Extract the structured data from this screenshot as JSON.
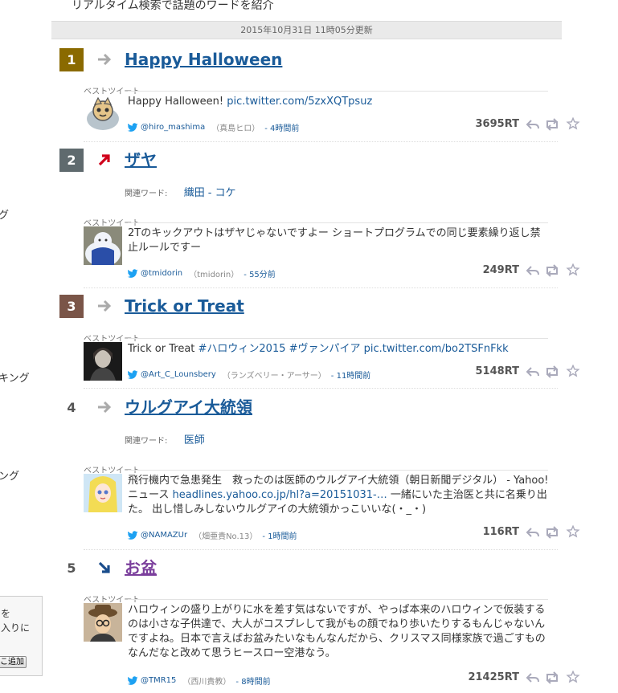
{
  "header": {
    "tagline": "リアルタイム検索で話題のワードを紹介",
    "updated": "2015年10月31日 11時05分更新"
  },
  "sidebar": {
    "frag1": "グ",
    "frag2": "キング",
    "frag3": "ング",
    "box_line1": "を",
    "box_line2": "入りに",
    "box_button": "こ追加"
  },
  "labels": {
    "best_tweet": "ベストツイート",
    "related": "関連ワード:"
  },
  "colors": {
    "rank1": "#8a6a00",
    "rank2": "#5f6a6e",
    "rank3": "#7a5548",
    "link": "#1a5b99",
    "visited": "#7b3f9c",
    "up": "#d0021b",
    "down": "#1a4d8c"
  },
  "rankings": [
    {
      "rank": "1",
      "trend": "flat-arrow-icon",
      "word": "Happy Halloween",
      "tweet": {
        "text": "Happy Halloween! ",
        "link": "pic.twitter.com/5zxXQTpsuz",
        "user": "@hiro_mashima",
        "name": "（真島ヒロ）",
        "time": "- 4時間前",
        "rt": "3695RT"
      }
    },
    {
      "rank": "2",
      "trend": "up-arrow-icon",
      "word": "ザヤ",
      "related": [
        "織田",
        "コケ"
      ],
      "tweet": {
        "text": "2Tのキックアウトはザヤじゃないですよー ショートプログラムでの同じ要素繰り返し禁止ルールですー",
        "link": "",
        "user": "@tmidorin",
        "name": "（tmidorin）",
        "time": "- 55分前",
        "rt": "249RT"
      }
    },
    {
      "rank": "3",
      "trend": "flat-arrow-icon",
      "word": "Trick or Treat",
      "tweet": {
        "text": "Trick or Treat  ",
        "link": "#ハロウィン2015 #ヴァンパイア pic.twitter.com/bo2TSFnFkk",
        "user": "@Art_C_Lounsbery",
        "name": "（ランズベリー・アーサー）",
        "time": "- 11時間前",
        "rt": "5148RT"
      }
    },
    {
      "rank": "4",
      "trend": "flat-arrow-icon",
      "word": "ウルグアイ大統領",
      "related": [
        "医師"
      ],
      "tweet": {
        "text_a": "飛行機内で急患発生　救ったのは医師のウルグアイ大統領（朝日新聞デジタル） - Yahoo!ニュース ",
        "link": "headlines.yahoo.co.jp/hl?a=20151031-…",
        "text_b": "  一緒にいた主治医と共に名乗り出た。 出し惜しみしないウルグアイの大統領かっこいいな(・_・)",
        "user": "@NAMAZUr",
        "name": "（畑亜貴No.13）",
        "time": "- 1時間前",
        "rt": "116RT"
      }
    },
    {
      "rank": "5",
      "trend": "down-arrow-icon",
      "word": "お盆",
      "tweet": {
        "text": "ハロウィンの盛り上がりに水を差す気はないですが、やっぱ本来のハロウィンで仮装するのは小さな子供達で、大人がコスプレして我がもの顔でねり歩いたりするもんじゃないんですよね。日本で言えばお盆みたいなもんなんだから、クリスマス同様家族で過ごすものなんだなと改めて思うヒースロー空港なう。",
        "link": "",
        "user": "@TMR15",
        "name": "（西川貴教）",
        "time": "- 8時間前",
        "rt": "21425RT"
      }
    }
  ]
}
